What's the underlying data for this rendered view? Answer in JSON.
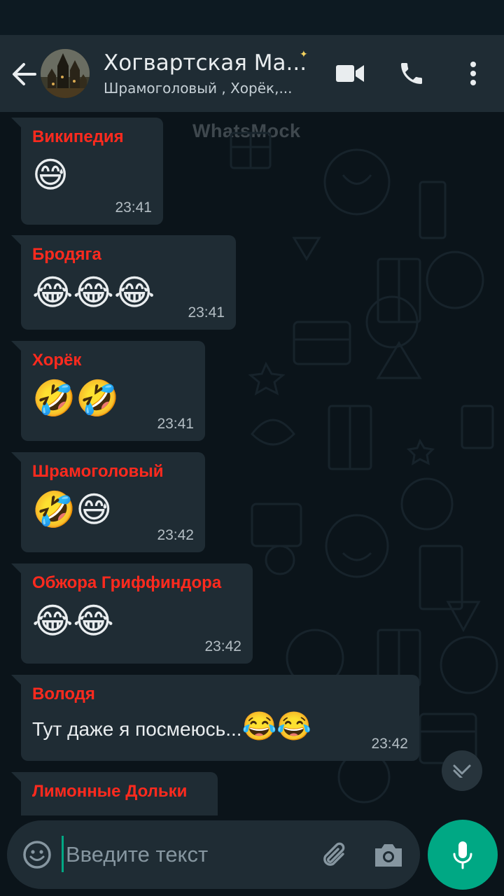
{
  "header": {
    "title": "Хогвартская Ма...",
    "subtitle": "Шрамоголовый , Хорёк,...",
    "watermark": "WhatsMock"
  },
  "messages": [
    {
      "sender": "Википедия",
      "content": "😅",
      "time": "23:41",
      "sender_color": "#ff2a1e"
    },
    {
      "sender": "Бродяга",
      "content": "😂😂😂",
      "time": "23:41",
      "sender_color": "#ff2a1e"
    },
    {
      "sender": "Хорёк",
      "content": "🤣🤣",
      "time": "23:41",
      "sender_color": "#ff2a1e"
    },
    {
      "sender": "Шрамоголовый",
      "content": "🤣😅",
      "time": "23:42",
      "sender_color": "#ff2a1e"
    },
    {
      "sender": "Обжора Гриффиндора",
      "content": "😂😂",
      "time": "23:42",
      "sender_color": "#ff2a1e"
    },
    {
      "sender": "Володя",
      "text": "Тут даже я посмеюсь...",
      "emojis": "😂😂",
      "time": "23:42",
      "sender_color": "#ff2a1e"
    },
    {
      "sender": "Лимонные Дольки",
      "sender_color": "#ff2a1e"
    }
  ],
  "input": {
    "placeholder": "Введите текст"
  },
  "colors": {
    "header_bg": "#1f2c34",
    "bubble_bg": "#1f2c34",
    "accent": "#00a884",
    "chat_bg": "#0b141a"
  },
  "icons": [
    "back-arrow-icon",
    "video-call-icon",
    "phone-icon",
    "more-vert-icon",
    "emoji-icon",
    "attach-icon",
    "camera-icon",
    "mic-icon",
    "chevron-down-icon"
  ]
}
